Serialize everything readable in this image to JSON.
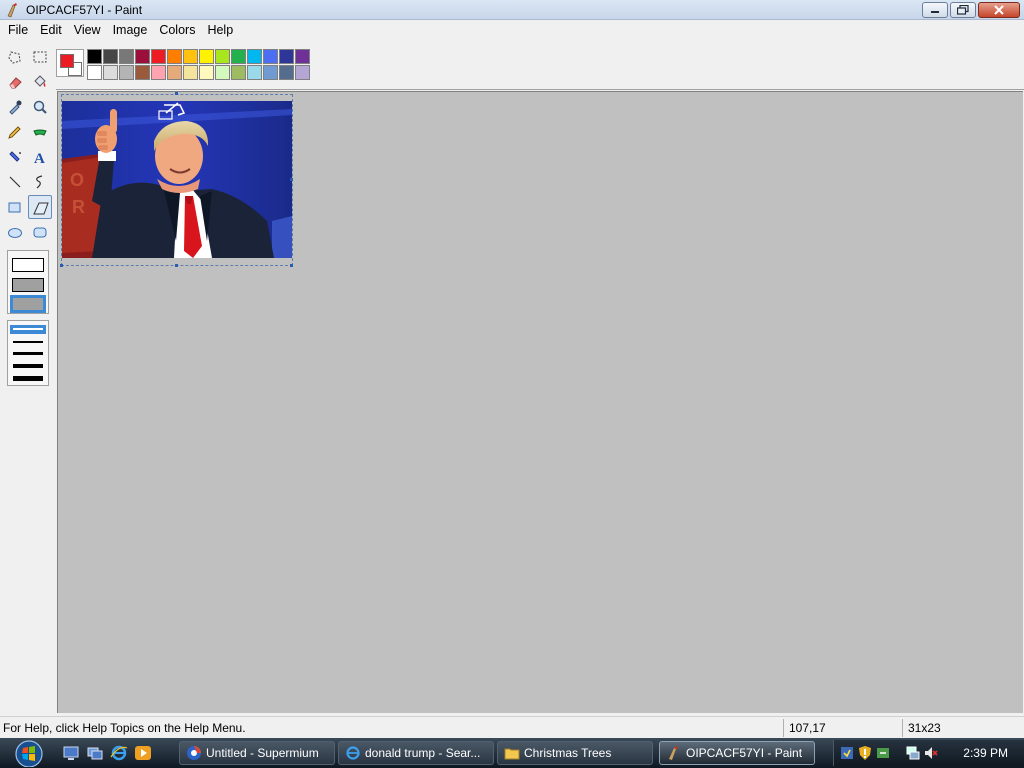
{
  "window": {
    "title": "OIPCACF57YI - Paint",
    "icon": "paint-icon"
  },
  "menu": [
    "File",
    "Edit",
    "View",
    "Image",
    "Colors",
    "Help"
  ],
  "tools": [
    {
      "name": "free-form-select",
      "icon": "free-select-icon"
    },
    {
      "name": "select",
      "icon": "rect-select-icon"
    },
    {
      "name": "eraser",
      "icon": "eraser-icon"
    },
    {
      "name": "fill",
      "icon": "fill-bucket-icon"
    },
    {
      "name": "pick-color",
      "icon": "eyedropper-icon"
    },
    {
      "name": "magnifier",
      "icon": "magnifier-icon"
    },
    {
      "name": "pencil",
      "icon": "pencil-icon"
    },
    {
      "name": "brush",
      "icon": "brush-icon"
    },
    {
      "name": "airbrush",
      "icon": "airbrush-icon"
    },
    {
      "name": "text",
      "icon": "text-icon"
    },
    {
      "name": "line",
      "icon": "line-icon"
    },
    {
      "name": "curve",
      "icon": "curve-icon"
    },
    {
      "name": "rectangle",
      "icon": "rectangle-icon"
    },
    {
      "name": "polygon",
      "icon": "polygon-icon",
      "selected": true
    },
    {
      "name": "ellipse",
      "icon": "ellipse-icon"
    },
    {
      "name": "rounded-rectangle",
      "icon": "rounded-rect-icon"
    }
  ],
  "colors": {
    "foreground": "#ed1c24",
    "background": "#ffffff",
    "palette_row1": [
      "#000000",
      "#464646",
      "#787878",
      "#9c0f3c",
      "#ed1c24",
      "#ff7e00",
      "#ffc20e",
      "#fff200",
      "#a8e61d",
      "#22b14c",
      "#00b7ef",
      "#4d6df3",
      "#2f3699",
      "#6f3198"
    ],
    "palette_row2": [
      "#ffffff",
      "#dcdcdc",
      "#b4b4b4",
      "#9c5a3c",
      "#ffa3b1",
      "#e5aa7a",
      "#f5e49c",
      "#fff9bd",
      "#d3f9bc",
      "#9dbb61",
      "#99d9ea",
      "#709ad1",
      "#546d8e",
      "#b5a5d5"
    ]
  },
  "status": {
    "help": "For Help, click Help Topics on the Help Menu.",
    "coords": "107,17",
    "size": "31x23"
  },
  "taskbar": {
    "quick_launch": [
      "show-desktop-icon",
      "switch-windows-icon",
      "internet-explorer-icon",
      "media-player-icon"
    ],
    "buttons": [
      {
        "label": "Untitled - Supermium",
        "icon": "browser-icon"
      },
      {
        "label": "donald trump - Sear...",
        "icon": "internet-explorer-icon"
      },
      {
        "label": "Christmas Trees",
        "icon": "folder-icon"
      },
      {
        "label": "OIPCACF57YI - Paint",
        "icon": "paint-icon",
        "active": true
      }
    ],
    "tray_icons": [
      "windows-update-icon",
      "shield-warning-icon",
      "network-status-icon",
      "monitor-network-icon",
      "volume-muted-icon"
    ],
    "clock": "2:39 PM"
  }
}
